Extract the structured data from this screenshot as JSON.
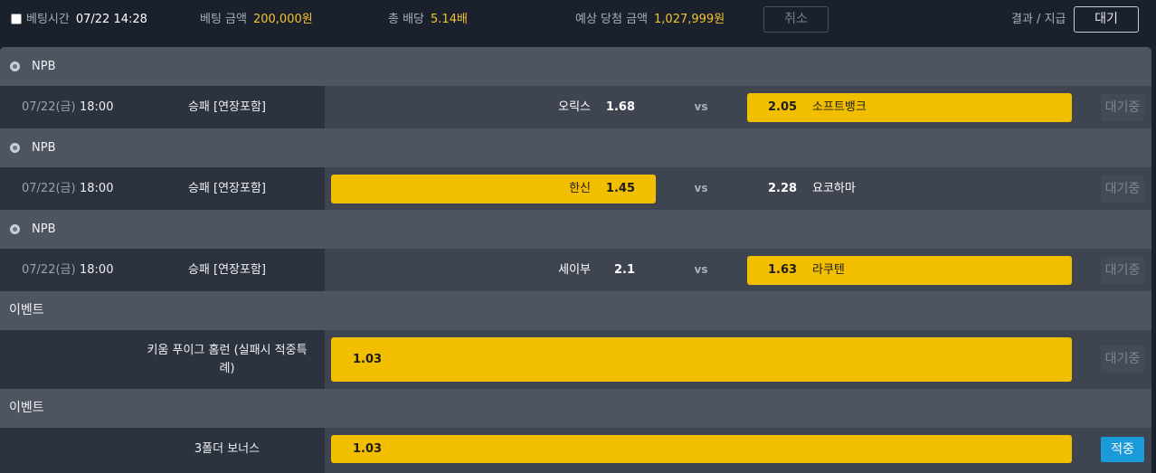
{
  "header": {
    "bet_time_label": "베팅시간",
    "bet_time_value": "07/22 14:28",
    "bet_amount_label": "베팅 금액",
    "bet_amount_value": "200,000원",
    "total_odds_label": "총 배당",
    "total_odds_value": "5.14배",
    "expected_win_label": "예상 당첨 금액",
    "expected_win_value": "1,027,999원",
    "cancel_label": "취소",
    "result_label": "결과 / 지급",
    "result_value": "대기"
  },
  "matches": [
    {
      "league": "NPB",
      "date": "07/22(금)",
      "time": "18:00",
      "bet_type": "승패 [연장포함]",
      "home_team": "오릭스",
      "home_odds": "1.68",
      "vs": "vs",
      "away_odds": "2.05",
      "away_team": "소프트뱅크",
      "selected": "away",
      "status": "대기중"
    },
    {
      "league": "NPB",
      "date": "07/22(금)",
      "time": "18:00",
      "bet_type": "승패 [연장포함]",
      "home_team": "한신",
      "home_odds": "1.45",
      "vs": "vs",
      "away_odds": "2.28",
      "away_team": "요코하마",
      "selected": "home",
      "status": "대기중"
    },
    {
      "league": "NPB",
      "date": "07/22(금)",
      "time": "18:00",
      "bet_type": "승패 [연장포함]",
      "home_team": "세이부",
      "home_odds": "2.1",
      "vs": "vs",
      "away_odds": "1.63",
      "away_team": "라쿠텐",
      "selected": "away",
      "status": "대기중"
    }
  ],
  "events": [
    {
      "section": "이벤트",
      "name_line1": "키움 푸이그 홈런 (실패시 적중특",
      "name_line2": "례)",
      "odds": "1.03",
      "status": "대기중"
    },
    {
      "section": "이벤트",
      "name": "3폴더 보너스",
      "odds": "1.03",
      "status": "적중"
    }
  ],
  "colors": {
    "background": "#1b212c",
    "panel": "#4e5560",
    "selected_odds": "#f2be00",
    "hit_status": "#1a9ad8",
    "gold_text": "#f0c330"
  }
}
